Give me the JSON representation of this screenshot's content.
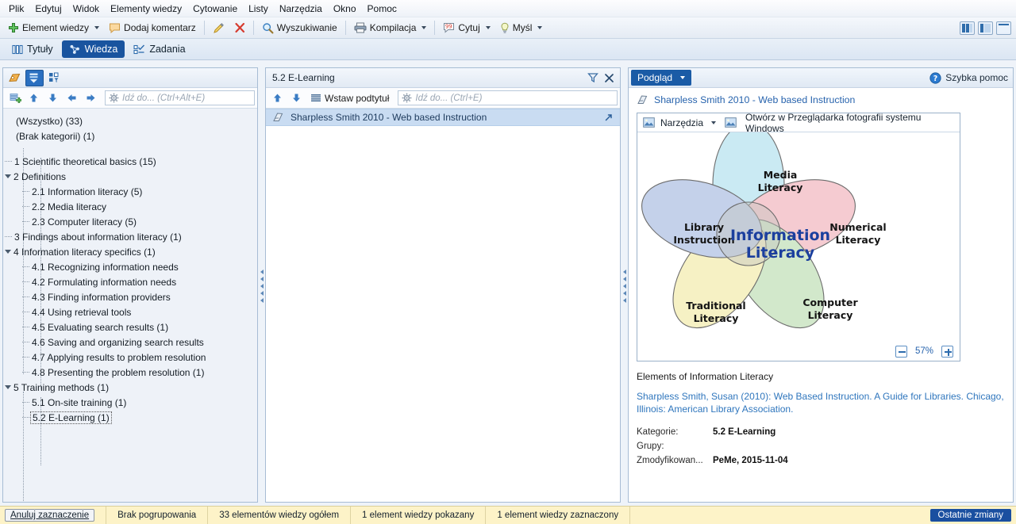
{
  "menu": {
    "items": [
      "Plik",
      "Edytuj",
      "Widok",
      "Elementy wiedzy",
      "Cytowanie",
      "Listy",
      "Narzędzia",
      "Okno",
      "Pomoc"
    ]
  },
  "toolbar": {
    "knowledge_item": "Element wiedzy",
    "add_comment": "Dodaj komentarz",
    "search": "Wyszukiwanie",
    "compilation": "Kompilacja",
    "quote": "Cytuj",
    "thought": "Myśl"
  },
  "mode_tabs": [
    {
      "label": "Tytuły",
      "icon": "books-icon",
      "active": false
    },
    {
      "label": "Wiedza",
      "icon": "network-icon",
      "active": true
    },
    {
      "label": "Zadania",
      "icon": "tasks-icon",
      "active": false
    }
  ],
  "left_panel": {
    "goto_placeholder": "Idź do... (Ctrl+Alt+E)",
    "tree": [
      {
        "label": "(Wszystko) (33)",
        "indent": 0,
        "type": "plain",
        "selected": false
      },
      {
        "label": "(Brak kategorii) (1)",
        "indent": 0,
        "type": "plain",
        "selected": false
      },
      {
        "label": "1 Scientific theoretical basics (15)",
        "indent": 0,
        "type": "leaf",
        "selected": false
      },
      {
        "label": "2 Definitions",
        "indent": 0,
        "type": "node",
        "selected": false
      },
      {
        "label": "2.1 Information literacy (5)",
        "indent": 1,
        "type": "leaf",
        "selected": false
      },
      {
        "label": "2.2 Media literacy",
        "indent": 1,
        "type": "leaf",
        "selected": false
      },
      {
        "label": "2.3 Computer literacy (5)",
        "indent": 1,
        "type": "leaf",
        "selected": false
      },
      {
        "label": "3 Findings about information literacy (1)",
        "indent": 0,
        "type": "leaf",
        "selected": false
      },
      {
        "label": "4 Information literacy specifics (1)",
        "indent": 0,
        "type": "node",
        "selected": false
      },
      {
        "label": "4.1 Recognizing information needs",
        "indent": 1,
        "type": "leaf",
        "selected": false
      },
      {
        "label": "4.2 Formulating information needs",
        "indent": 1,
        "type": "leaf",
        "selected": false
      },
      {
        "label": "4.3 Finding information providers",
        "indent": 1,
        "type": "leaf",
        "selected": false
      },
      {
        "label": "4.4 Using retrieval tools",
        "indent": 1,
        "type": "leaf",
        "selected": false
      },
      {
        "label": "4.5 Evaluating search results (1)",
        "indent": 1,
        "type": "leaf",
        "selected": false
      },
      {
        "label": "4.6 Saving and organizing search results",
        "indent": 1,
        "type": "leaf",
        "selected": false
      },
      {
        "label": "4.7 Applying results to problem resolution",
        "indent": 1,
        "type": "leaf",
        "selected": false
      },
      {
        "label": "4.8 Presenting the problem resolution (1)",
        "indent": 1,
        "type": "leaf",
        "selected": false
      },
      {
        "label": "5 Training methods (1)",
        "indent": 0,
        "type": "node",
        "selected": false
      },
      {
        "label": "5.1 On-site training (1)",
        "indent": 1,
        "type": "leaf",
        "selected": false
      },
      {
        "label": "5.2 E-Learning (1)",
        "indent": 1,
        "type": "leaf",
        "selected": true
      }
    ]
  },
  "mid_panel": {
    "title": "5.2 E-Learning",
    "insert_subtitle": "Wstaw podtytuł",
    "goto_placeholder": "Idź do... (Ctrl+E)",
    "rows": [
      {
        "label": "Sharpless Smith 2010 - Web based Instruction"
      }
    ]
  },
  "right_panel": {
    "mode_button": "Podgląd",
    "quick_help": "Szybka pomoc",
    "document_title": "Sharpless Smith 2010 - Web based Instruction",
    "image_tools": {
      "tools_label": "Narzędzia",
      "open_with": "Otwórz w Przeglądarka fotografii systemu Windows"
    },
    "zoom_percent": "57%",
    "caption": "Elements of Information Literacy",
    "citation": "Sharpless Smith, Susan (2010): Web Based Instruction. A Guide for Libraries. Chicago, Illinois: American Library Association.",
    "meta": [
      {
        "key": "Kategorie:",
        "value": "5.2 E-Learning"
      },
      {
        "key": "Grupy:",
        "value": ""
      },
      {
        "key": "Zmodyfikowan...",
        "value": "PeMe, 2015-11-04"
      }
    ]
  },
  "chart_data": {
    "type": "venn",
    "title": "Elements of Information Literacy",
    "center_label": "Information Literacy",
    "sets": [
      {
        "name": "Media Literacy",
        "color": "#cfeaf2",
        "stroke": "#4a4a4a",
        "angle": 0
      },
      {
        "name": "Numerical Literacy",
        "color": "#f6ccd0",
        "stroke": "#4a4a4a",
        "angle": 72
      },
      {
        "name": "Computer Literacy",
        "color": "#d5e9cf",
        "stroke": "#4a4a4a",
        "angle": 144
      },
      {
        "name": "Traditional Literacy",
        "color": "#f6eec4",
        "stroke": "#4a4a4a",
        "angle": 216
      },
      {
        "name": "Library Instruction",
        "color": "#c5d2ea",
        "stroke": "#4a4a4a",
        "angle": 288
      }
    ],
    "center_color": "#1b3f9e"
  },
  "status_bar": {
    "cancel_selection": "Anuluj zaznaczenie",
    "cells": [
      "Brak pogrupowania",
      "33 elementów wiedzy ogółem",
      "1 element wiedzy pokazany",
      "1 element wiedzy zaznaczony"
    ],
    "last_changes": "Ostatnie zmiany"
  },
  "colors": {
    "accent": "#1a5ba6",
    "status_bg": "#fdf3c8",
    "selection": "#c9dcf2"
  }
}
